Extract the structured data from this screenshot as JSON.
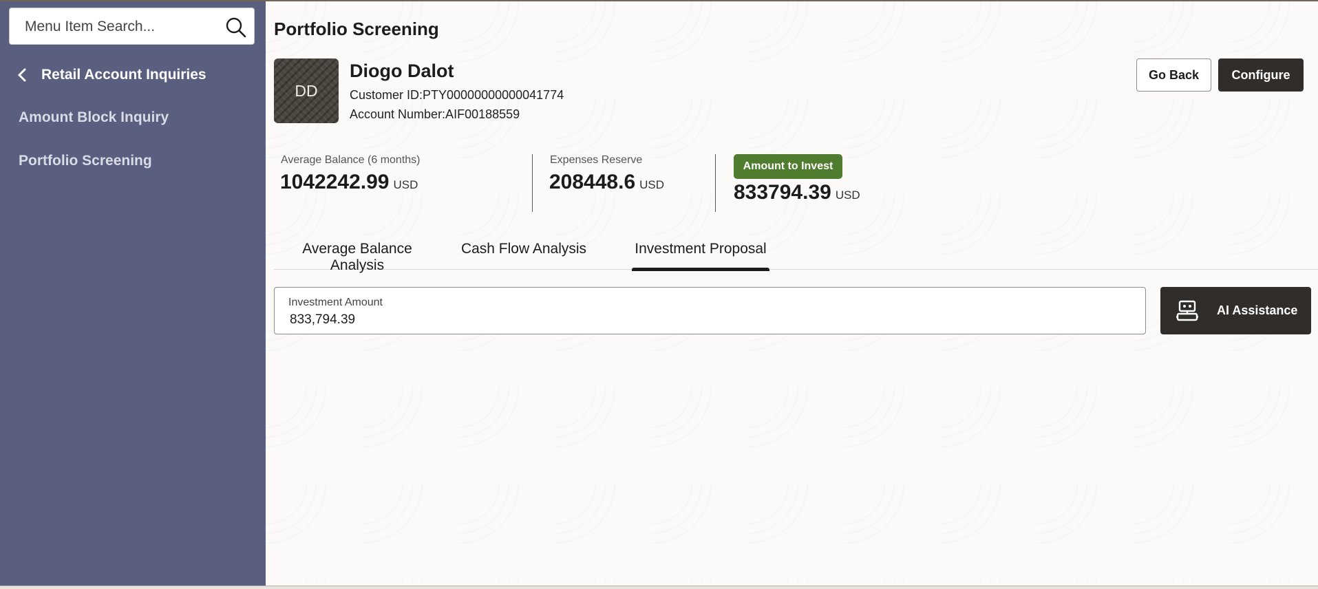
{
  "sidebar": {
    "search_placeholder": "Menu Item Search...",
    "back_label": "Retail Account Inquiries",
    "items": [
      {
        "label": "Amount Block Inquiry"
      },
      {
        "label": "Portfolio Screening"
      }
    ]
  },
  "header": {
    "title": "Portfolio Screening",
    "go_back_label": "Go Back",
    "configure_label": "Configure"
  },
  "customer": {
    "initials": "DD",
    "name": "Diogo Dalot",
    "customer_id": "Customer ID:PTY00000000000041774",
    "account_number": "Account Number:AIF00188559"
  },
  "metrics": {
    "average_balance": {
      "label": "Average Balance (6 months)",
      "value": "1042242.99",
      "currency": "USD"
    },
    "expenses_reserve": {
      "label": "Expenses Reserve",
      "value": "208448.6",
      "currency": "USD"
    },
    "amount_to_invest": {
      "label": "Amount to Invest",
      "value": "833794.39",
      "currency": "USD"
    }
  },
  "tabs": [
    {
      "label": "Average Balance Analysis",
      "active": false
    },
    {
      "label": "Cash Flow Analysis",
      "active": false
    },
    {
      "label": "Investment Proposal",
      "active": true
    }
  ],
  "investment": {
    "field_label": "Investment Amount",
    "field_value": "833,794.39",
    "ai_button_label": "AI Assistance"
  },
  "colors": {
    "sidebar_bg": "#5a5f7f",
    "primary_button": "#312d2a",
    "invest_badge": "#4f7c2e"
  },
  "icons": {
    "search": "search-icon",
    "back": "chevron-left-icon",
    "ai": "robot-icon"
  }
}
